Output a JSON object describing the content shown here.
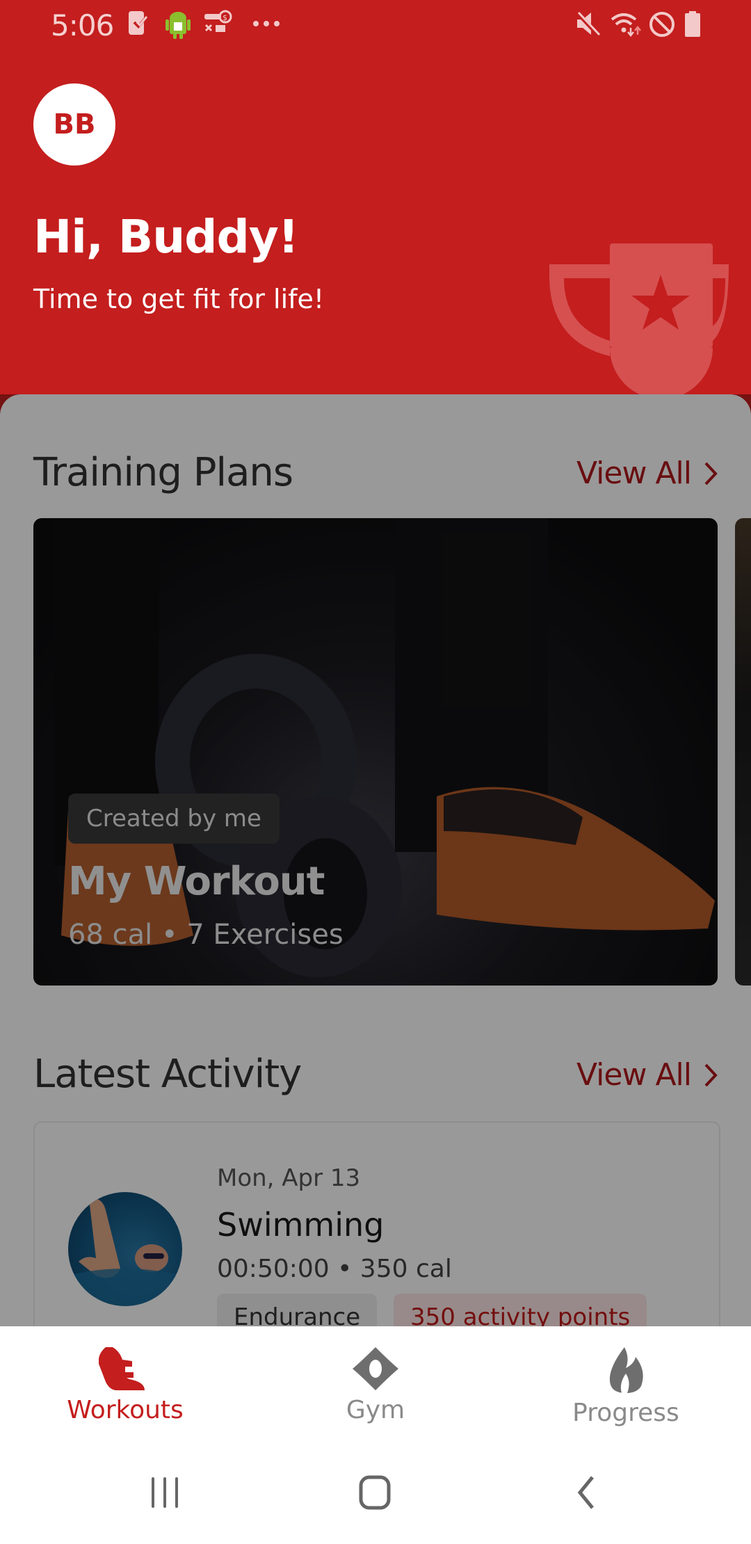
{
  "status_bar": {
    "time": "5:06",
    "left_icons": [
      "task-check-icon",
      "android-icon",
      "vpn-key-icon",
      "more-dots-icon"
    ],
    "right_icons": [
      "mute-icon",
      "wifi-icon",
      "do-not-disturb-icon",
      "battery-icon"
    ]
  },
  "header": {
    "avatar_initials": "BB",
    "greeting": "Hi, Buddy!",
    "tagline": "Time to get fit for life!",
    "decoration_icon": "trophy-icon"
  },
  "training_plans": {
    "title": "Training Plans",
    "view_all_label": "View All",
    "cards": [
      {
        "badge": "Created by me",
        "title": "My Workout",
        "meta": "68 cal • 7 Exercises"
      }
    ]
  },
  "latest_activity": {
    "title": "Latest Activity",
    "view_all_label": "View All",
    "items": [
      {
        "date": "Mon, Apr 13",
        "title": "Swimming",
        "meta": "00:50:00 • 350 cal",
        "tags": [
          "Endurance",
          "350 activity points"
        ]
      }
    ]
  },
  "bottom_nav": {
    "items": [
      {
        "label": "Workouts",
        "icon": "shoe-icon",
        "active": true
      },
      {
        "label": "Gym",
        "icon": "location-pin-icon",
        "active": false
      },
      {
        "label": "Progress",
        "icon": "flame-icon",
        "active": false
      }
    ]
  },
  "system_nav": [
    "recent-apps-icon",
    "home-icon",
    "back-icon"
  ],
  "colors": {
    "brand_red": "#C41E1E",
    "link_red": "#B0181C",
    "inactive_gray": "#6E6E6E"
  }
}
